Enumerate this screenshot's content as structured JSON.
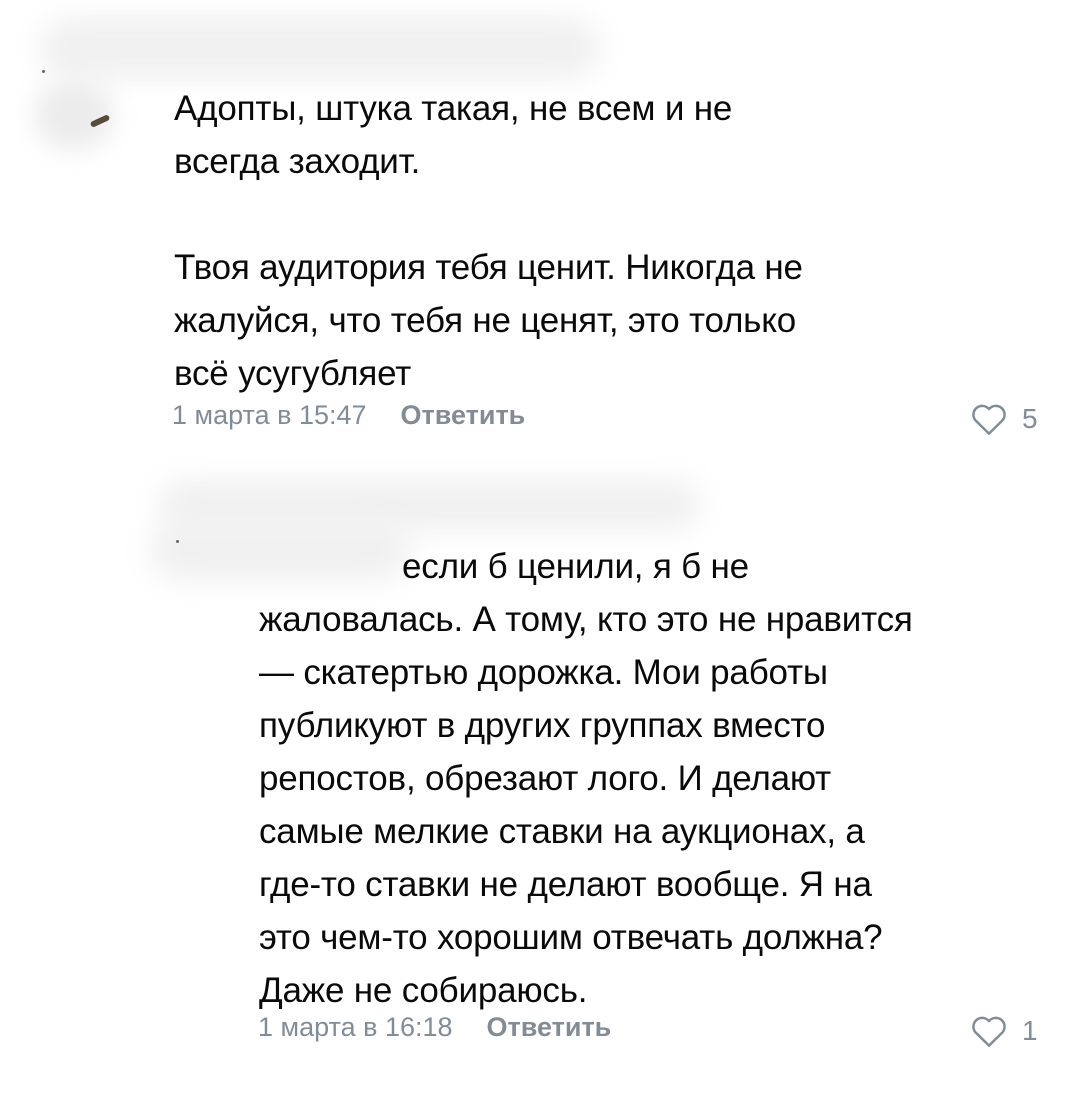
{
  "comments": [
    {
      "text": "Адопты, штука такая, не всем и не\nвсегда заходит.\n\nТвоя аудитория тебя ценит. Никогда не\nжалуйся, что тебя не ценят, это только\nвсё усугубляет",
      "date": "1 марта в 15:47",
      "reply_label": "Ответить",
      "likes": "5"
    },
    {
      "text_first": "если б ценили, я б не",
      "text_rest": "жаловалась. А тому, кто это не нравится\n— скатертью дорожка. Мои работы\nпубликуют в других группах вместо\nрепостов, обрезают лого. И делают\nсамые мелкие ставки на аукционах, а\nгде-то ставки не делают вообще. Я на\nэто чем-то хорошим отвечать должна?\nДаже не собираюсь.",
      "date": "1 марта в 16:18",
      "reply_label": "Ответить",
      "likes": "1"
    }
  ],
  "icons": {
    "like": "heart-outline-icon"
  },
  "colors": {
    "text": "#0a0a0a",
    "meta": "#818c99",
    "background": "#ffffff"
  }
}
